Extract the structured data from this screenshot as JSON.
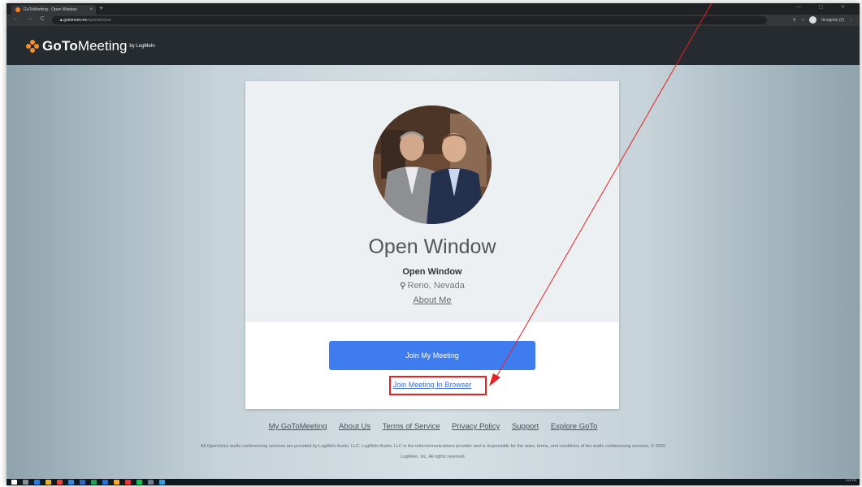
{
  "browser": {
    "tab_title": "GoToMeeting - Open Window",
    "tab_close": "×",
    "new_tab": "+",
    "window_controls": "—  ▢  ✕",
    "nav_icons": "← → C ⌂",
    "url_host": "gotomeet.me",
    "url_path": "/openwindow",
    "profile_label": "Incognito (2)"
  },
  "header": {
    "brand_bold": "GoTo",
    "brand_regular": "Meeting",
    "brand_by": "by LogMeIn"
  },
  "profile": {
    "title": "Open Window",
    "name": "Open Window",
    "location": "Reno, Nevada",
    "about_link": "About Me"
  },
  "actions": {
    "join_button": "Join My Meeting",
    "join_browser_link": "Join Meeting In Browser"
  },
  "footer": {
    "links": [
      "My GoToMeeting",
      "About Us",
      "Terms of Service",
      "Privacy Policy",
      "Support",
      "Explore GoTo"
    ],
    "legal_line1": "All OpenVoice audio conferencing services are provided by LogMeIn Audio, LLC. LogMeIn Audio, LLC is the telecommunications provider and is responsible for the rates, terms, and conditions of the audio conferencing services. © 2020",
    "legal_line2": "LogMeIn, Inc. All rights reserved."
  },
  "taskbar": {
    "time": "5:15 PM",
    "date": "8/18/2020"
  },
  "colors": {
    "accent_button": "#3f7cf0",
    "brand_orange": "#f68d2e",
    "annotation_red": "#e52121",
    "header_bg": "#262b2f"
  }
}
